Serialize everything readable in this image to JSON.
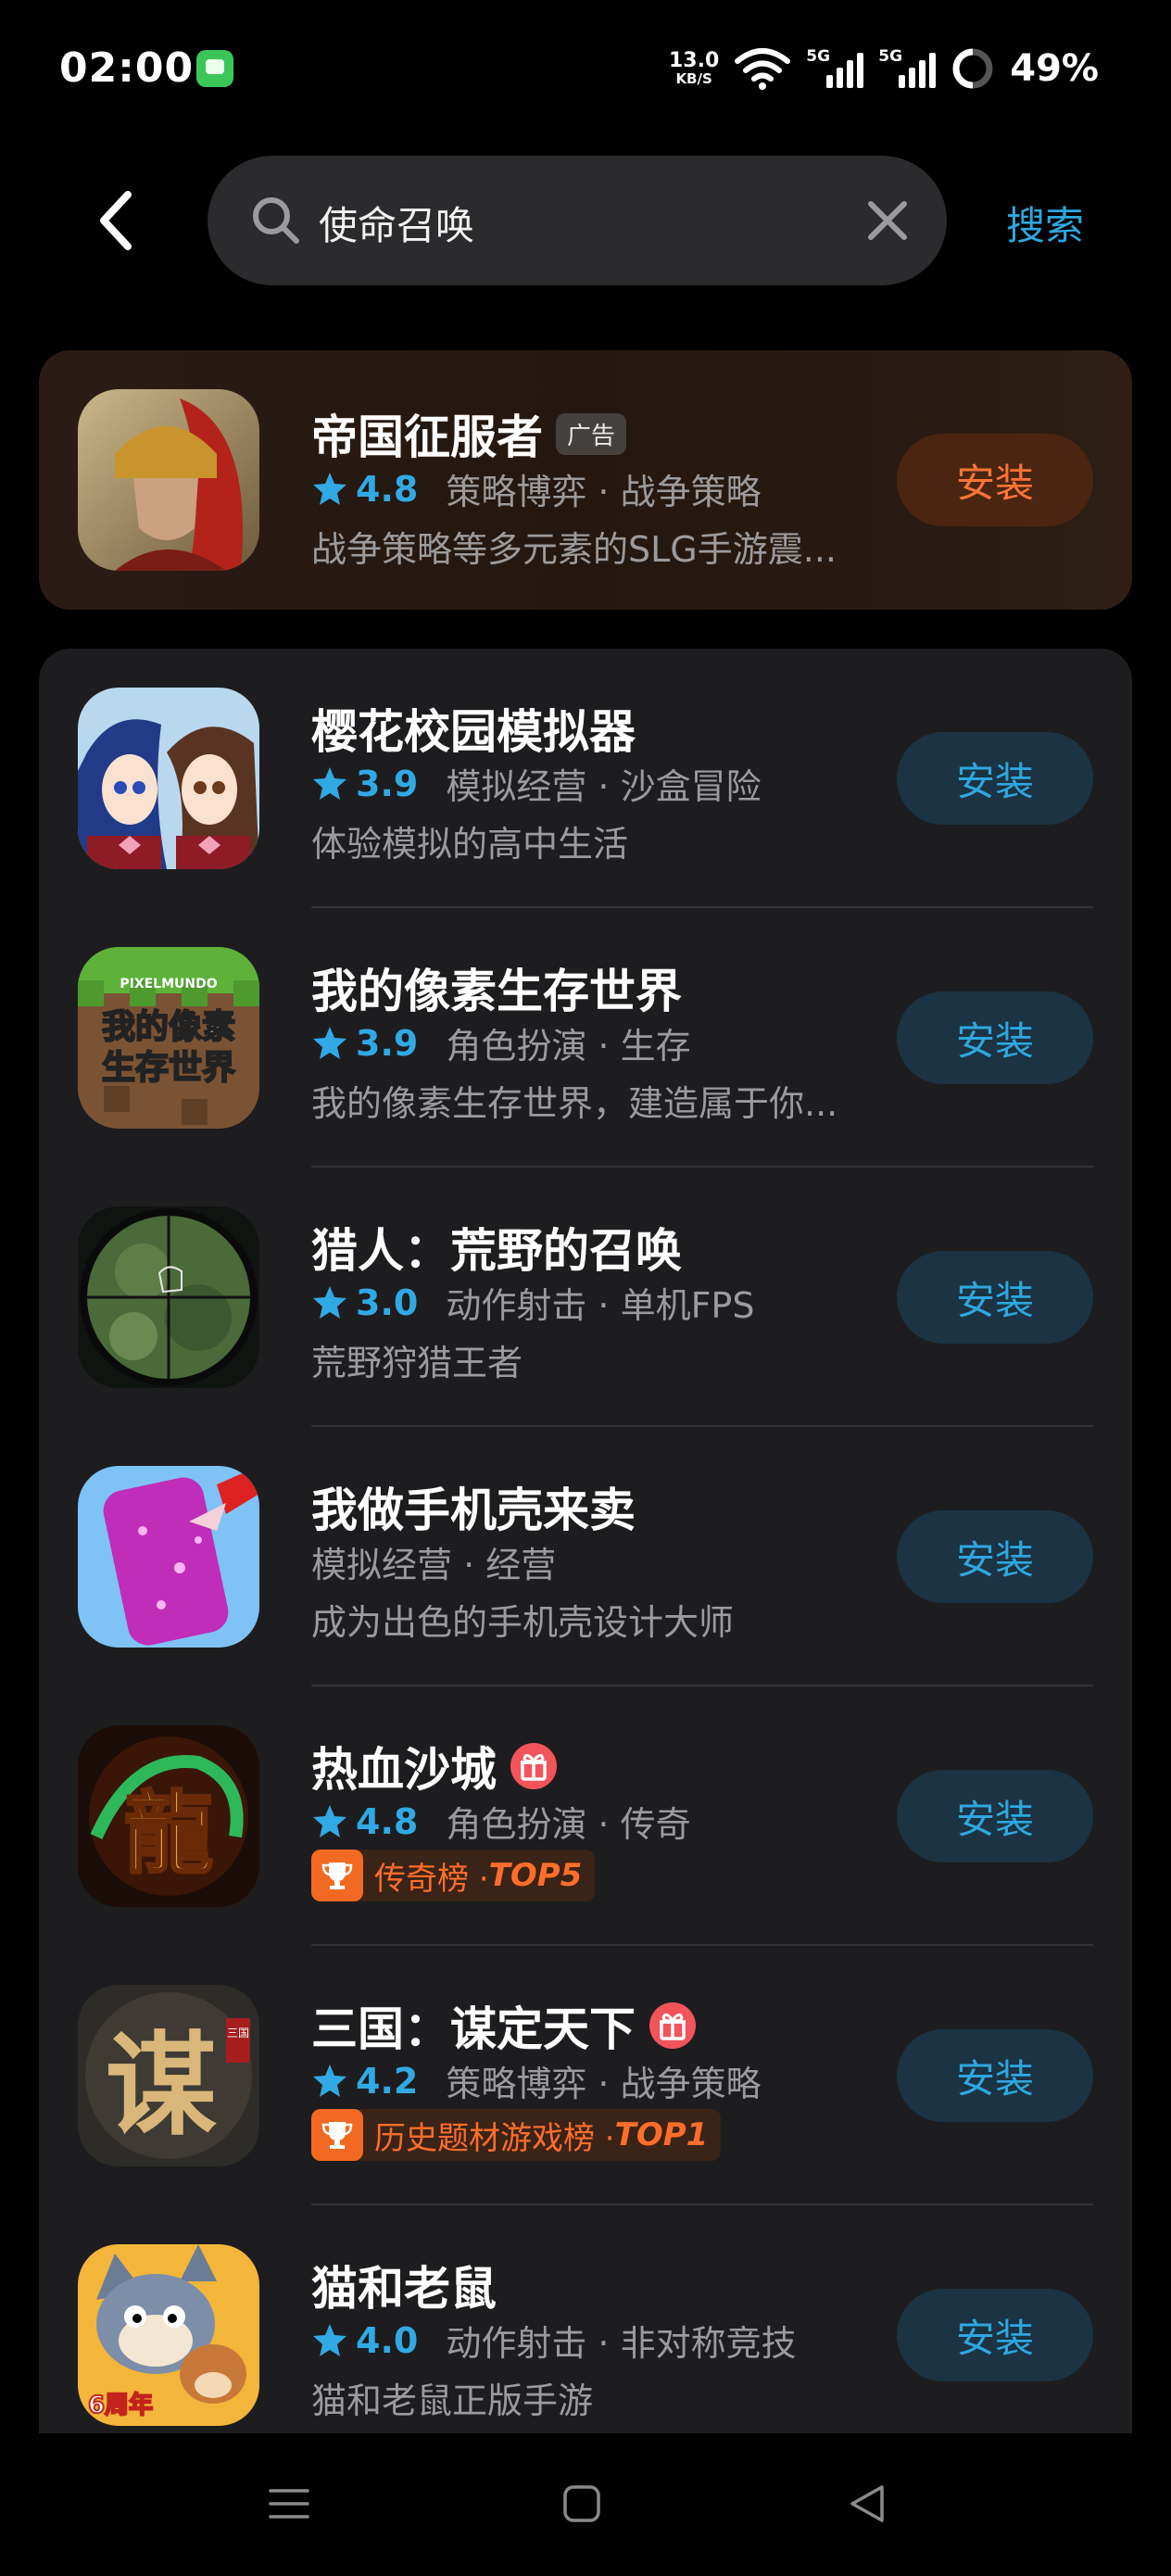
{
  "status_bar": {
    "time": "02:00",
    "net_speed": "13.0",
    "net_unit": "KB/S",
    "sim1": "5G",
    "sim2": "5G",
    "battery": "49%"
  },
  "search": {
    "query": "使命召唤",
    "button_label": "搜索"
  },
  "ad": {
    "name": "帝国征服者",
    "ad_label": "广告",
    "rating": "4.8",
    "tags": "策略博弈 · 战争策略",
    "desc": "战争策略等多元素的SLG手游震...",
    "install": "安装"
  },
  "apps": [
    {
      "name": "樱花校园模拟器",
      "rating": "3.9",
      "tags": "模拟经营 · 沙盒冒险",
      "desc": "体验模拟的高中生活",
      "install": "安装"
    },
    {
      "name": "我的像素生存世界",
      "rating": "3.9",
      "tags": "角色扮演 · 生存",
      "desc": "我的像素生存世界，建造属于你...",
      "install": "安装"
    },
    {
      "name": "猎人：荒野的召唤",
      "rating": "3.0",
      "tags": "动作射击 · 单机FPS",
      "desc": "荒野狩猎王者",
      "install": "安装"
    },
    {
      "name": "我做手机壳来卖",
      "tags": "模拟经营 · 经营",
      "desc": "成为出色的手机壳设计大师",
      "install": "安装"
    },
    {
      "name": "热血沙城",
      "rating": "4.8",
      "tags": "角色扮演 · 传奇",
      "rank_label": "传奇榜 · ",
      "rank_top": "TOP5",
      "install": "安装"
    },
    {
      "name": "三国：谋定天下",
      "rating": "4.2",
      "tags": "策略博弈 · 战争策略",
      "rank_label": "历史题材游戏榜 · ",
      "rank_top": "TOP1",
      "install": "安装"
    },
    {
      "name": "猫和老鼠",
      "rating": "4.0",
      "tags": "动作射击 · 非对称竞技",
      "desc": "猫和老鼠正版手游",
      "install": "安装"
    }
  ],
  "icon_text": {
    "pixel_line1": "我的像素",
    "pixel_line2": "生存世界",
    "pixel_brand": "PIXELMUNDO",
    "sanguo_char": "谋",
    "sanguo_mark": "三国",
    "dragon_char": "龍",
    "tom_badge": "6周年"
  },
  "colors": {
    "accent": "#2ea7df",
    "ad_accent": "#ff7434",
    "rank": "#f26a21"
  }
}
